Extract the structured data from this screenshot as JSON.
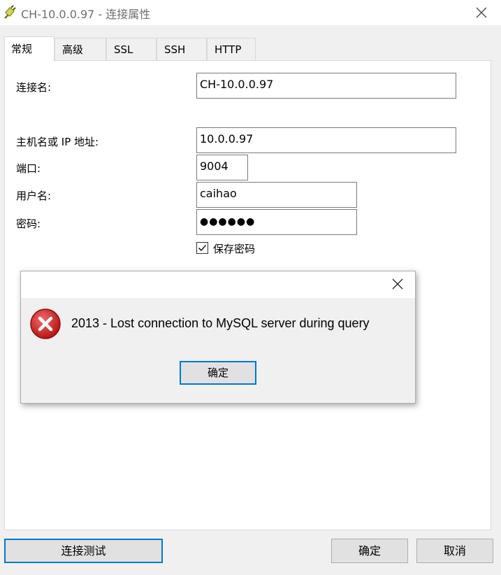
{
  "window": {
    "title": "CH-10.0.0.97 - 连接属性",
    "app_icon": "connection-plug-icon",
    "close_icon": "close-icon"
  },
  "tabs": [
    {
      "label": "常规",
      "active": true
    },
    {
      "label": "高级",
      "active": false
    },
    {
      "label": "SSL",
      "active": false
    },
    {
      "label": "SSH",
      "active": false
    },
    {
      "label": "HTTP",
      "active": false
    }
  ],
  "form": {
    "connection_name": {
      "label": "连接名:",
      "value": "CH-10.0.0.97"
    },
    "host": {
      "label": "主机名或 IP 地址:",
      "value": "10.0.0.97"
    },
    "port": {
      "label": "端口:",
      "value": "9004"
    },
    "username": {
      "label": "用户名:",
      "value": "caihao"
    },
    "password": {
      "label": "密码:",
      "value": "●●●●●●"
    },
    "save_password": {
      "label": "保存密码",
      "checked": true
    }
  },
  "buttons": {
    "test_connection": "连接测试",
    "ok": "确定",
    "cancel": "取消"
  },
  "error_dialog": {
    "message": "2013 - Lost connection to MySQL server during query",
    "ok_label": "确定",
    "icon": "error-icon",
    "close_icon": "close-icon"
  },
  "colors": {
    "accent": "#0078d7",
    "dialog_bg": "#f0f0f0",
    "error_red": "#d32f2f"
  }
}
